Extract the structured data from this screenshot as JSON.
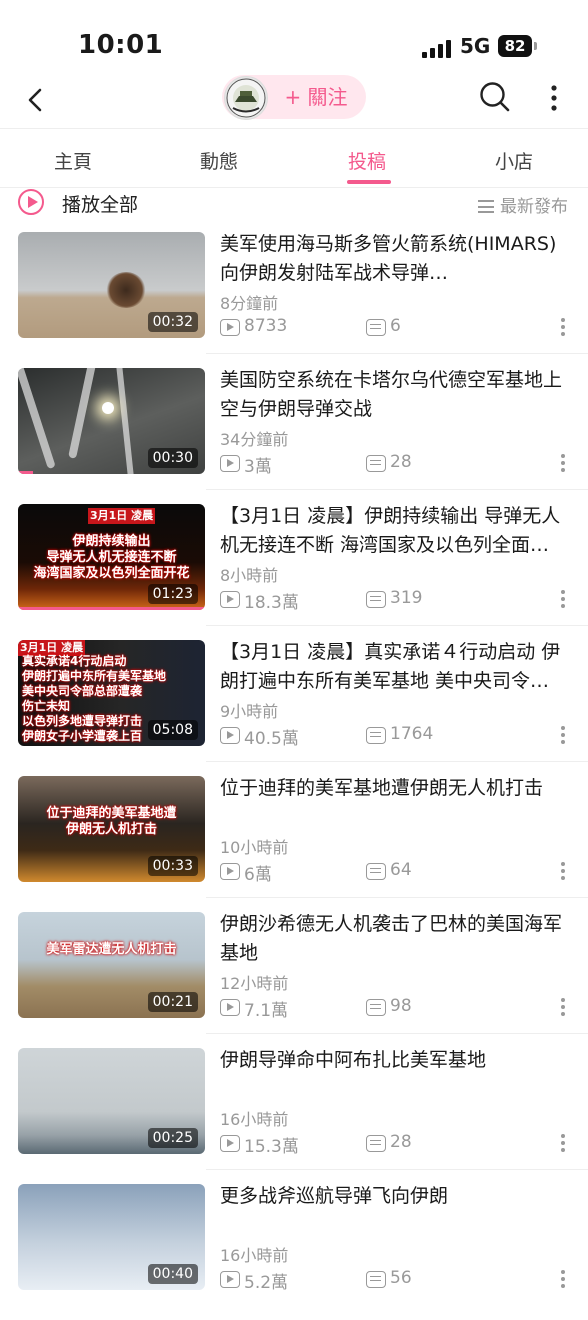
{
  "status_bar": {
    "time": "10:01",
    "network": "5G",
    "battery": "82"
  },
  "nav": {
    "follow_label": "+ 關注"
  },
  "tabs": [
    {
      "label": "主頁"
    },
    {
      "label": "動態"
    },
    {
      "label": "投稿",
      "active": true
    },
    {
      "label": "小店"
    }
  ],
  "toolbar": {
    "play_all": "播放全部",
    "sort": "最新發布"
  },
  "colors": {
    "accent": "#f45a8d",
    "muted": "#999999"
  },
  "videos": [
    {
      "title": "美军使用海马斯多管火箭系统(HIMARS) 向伊朗发射陆军战术导弹…",
      "time_ago": "8分鐘前",
      "views": "8733",
      "comments": "6",
      "duration": "00:32"
    },
    {
      "title": "美国防空系统在卡塔尔乌代德空军基地上空与伊朗导弹交战",
      "time_ago": "34分鐘前",
      "views": "3萬",
      "comments": "28",
      "duration": "00:30"
    },
    {
      "title": "【3月1日 凌晨】伊朗持续输出 导弹无人机无接连不断 海湾国家及以色列全面…",
      "time_ago": "8小時前",
      "views": "18.3萬",
      "comments": "319",
      "duration": "01:23",
      "caption_date": "3月1日 凌晨",
      "caption_lines": [
        "伊朗持续输出",
        "导弹无人机无接连不断",
        "海湾国家及以色列全面开花"
      ]
    },
    {
      "title": "【3月1日 凌晨】真实承诺４行动启动 伊朗打遍中东所有美军基地 美中央司令…",
      "time_ago": "9小時前",
      "views": "40.5萬",
      "comments": "1764",
      "duration": "05:08",
      "caption_date": "3月1日 凌晨",
      "caption_lines": [
        "真实承诺4行动启动",
        "伊朗打遍中东所有美军基地",
        "美中央司令部总部遭袭",
        "伤亡未知",
        "以色列多地遭导弹打击",
        "伊朗女子小学遭袭上百"
      ]
    },
    {
      "title": "位于迪拜的美军基地遭伊朗无人机打击",
      "time_ago": "10小時前",
      "views": "6萬",
      "comments": "64",
      "duration": "00:33",
      "caption_lines": [
        "位于迪拜的美军基地遭",
        "伊朗无人机打击"
      ]
    },
    {
      "title": "伊朗沙希德无人机袭击了巴林的美国海军基地",
      "time_ago": "12小時前",
      "views": "7.1萬",
      "comments": "98",
      "duration": "00:21",
      "caption_lines": [
        "美军雷达遭无人机打击"
      ]
    },
    {
      "title": "伊朗导弹命中阿布扎比美军基地",
      "time_ago": "16小時前",
      "views": "15.3萬",
      "comments": "28",
      "duration": "00:25"
    },
    {
      "title": "更多战斧巡航导弹飞向伊朗",
      "time_ago": "16小時前",
      "views": "5.2萬",
      "comments": "56",
      "duration": "00:40"
    }
  ]
}
